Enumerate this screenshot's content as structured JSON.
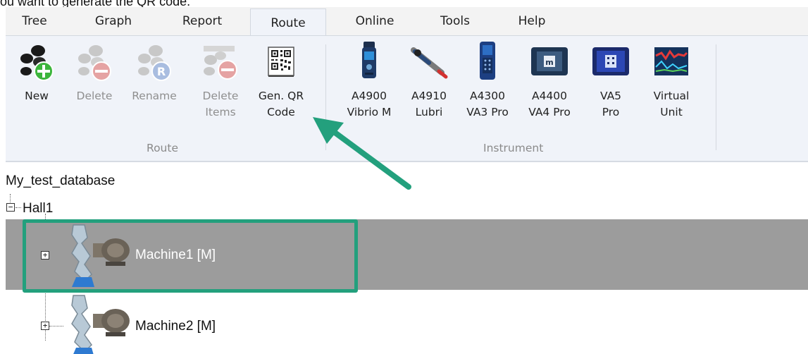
{
  "caption": "ou want to generate the QR code.",
  "tabs": [
    "Tree",
    "Graph",
    "Report",
    "Route",
    "Online",
    "Tools",
    "Help"
  ],
  "active_tab": "Route",
  "ribbon": {
    "route_group": {
      "label": "Route",
      "buttons": [
        {
          "line1": "New",
          "line2": "",
          "icon": "new-route-icon",
          "enabled": true
        },
        {
          "line1": "Delete",
          "line2": "",
          "icon": "delete-route-icon",
          "enabled": false
        },
        {
          "line1": "Rename",
          "line2": "",
          "icon": "rename-route-icon",
          "enabled": false
        },
        {
          "line1": "Delete",
          "line2": "Items",
          "icon": "delete-items-icon",
          "enabled": false
        },
        {
          "line1": "Gen. QR",
          "line2": "Code",
          "icon": "qr-code-icon",
          "enabled": true
        }
      ]
    },
    "instrument_group": {
      "label": "Instrument",
      "buttons": [
        {
          "line1": "A4900",
          "line2": "Vibrio M",
          "icon": "vibrio-m-icon"
        },
        {
          "line1": "A4910",
          "line2": "Lubri",
          "icon": "lubri-icon"
        },
        {
          "line1": "A4300",
          "line2": "VA3 Pro",
          "icon": "va3-pro-icon"
        },
        {
          "line1": "A4400",
          "line2": "VA4 Pro",
          "icon": "va4-pro-icon"
        },
        {
          "line1": "VA5",
          "line2": "Pro",
          "icon": "va5-pro-icon"
        },
        {
          "line1": "Virtual",
          "line2": "Unit",
          "icon": "virtual-unit-icon"
        }
      ]
    }
  },
  "tree": {
    "root": "My_test_database",
    "hall": "Hall1",
    "machines": [
      {
        "label": "Machine1 [M]",
        "selected": true,
        "icon": "machine-icon"
      },
      {
        "label": "Machine2 [M]",
        "selected": false,
        "icon": "machine-icon"
      }
    ]
  },
  "colors": {
    "annotation_accent": "#23a07d",
    "selected_row": "#9c9c9c",
    "ribbon_background": "#f0f3f9"
  }
}
